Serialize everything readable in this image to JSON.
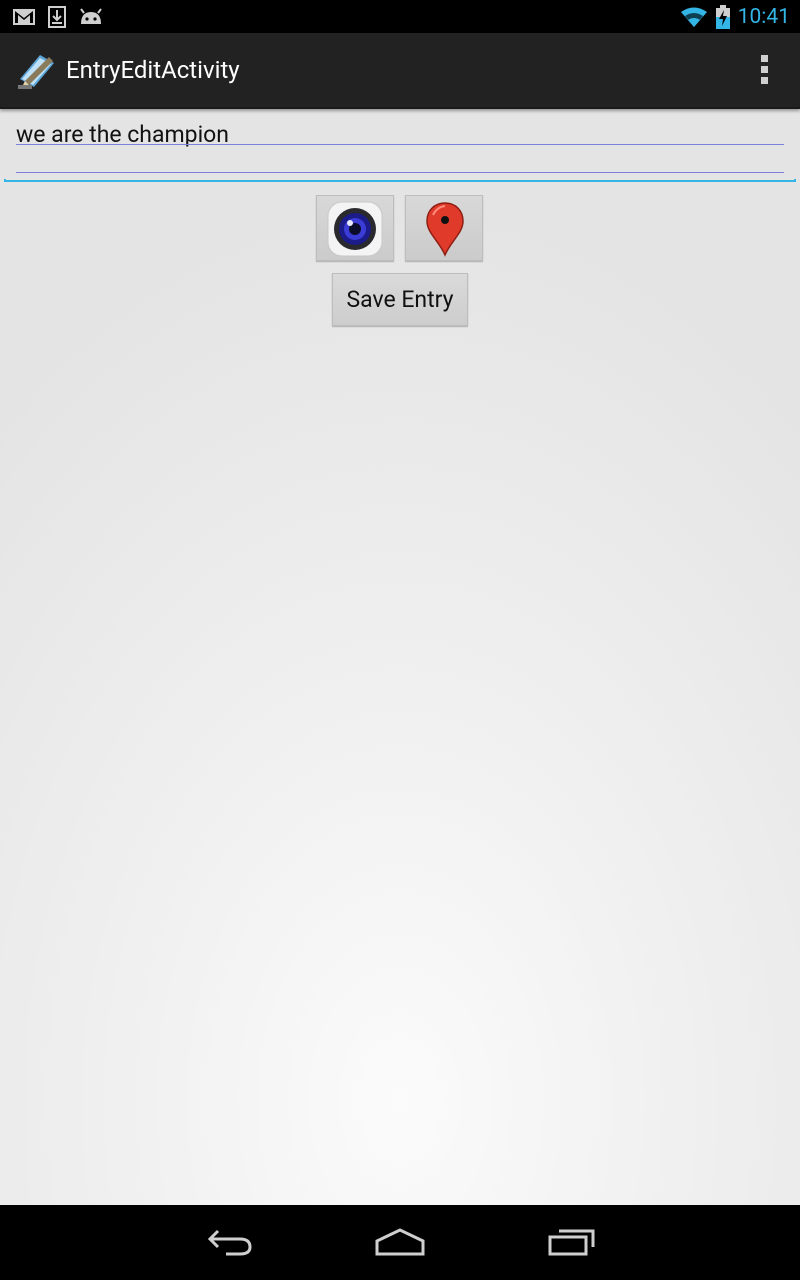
{
  "status_bar": {
    "time": "10:41",
    "left_icons": [
      "gmail-icon",
      "download-icon",
      "android-debug-icon"
    ],
    "right_icons": [
      "wifi-icon",
      "battery-charging-icon"
    ],
    "accent_color": "#33b5e5"
  },
  "action_bar": {
    "title": "EntryEditActivity",
    "app_icon": "notepad-pencil-icon",
    "overflow_icon": "overflow-menu-icon"
  },
  "editor": {
    "value": "we are the champion"
  },
  "buttons": {
    "camera_icon": "camera-icon",
    "location_icon": "map-pin-icon",
    "save_label": "Save Entry"
  },
  "nav_bar": {
    "icons": [
      "back-icon",
      "home-icon",
      "recent-apps-icon"
    ]
  }
}
